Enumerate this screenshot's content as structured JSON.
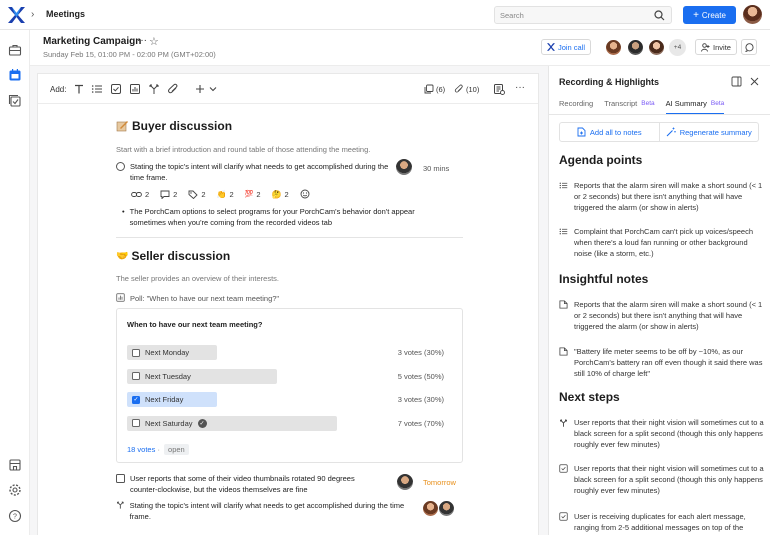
{
  "app": {
    "crumb": "Meetings",
    "search_placeholder": "Search",
    "create_label": "Create"
  },
  "colors": {
    "accent": "#1a6ef0",
    "beta": "#7a5af5",
    "later": "#e8901c"
  },
  "meeting": {
    "title": "Marketing Campaign",
    "datetime": "Sunday Feb 15, 01:00 PM - 02:00 PM (GMT+02:00)",
    "join_label": "Join call",
    "more_participants": "+4",
    "invite_label": "Invite"
  },
  "toolbar": {
    "add_label": "Add:",
    "notes_count": "(6)",
    "attachments_count": "(10)"
  },
  "buyer": {
    "heading": "Buyer discussion",
    "intro": "Start with a brief introduction and round table of those attending the meeting.",
    "task_text": "Stating the topic's intent will clarify what needs to get accomplished during the time frame.",
    "task_duration": "30 mins",
    "chips": [
      "2",
      "2",
      "2",
      "2",
      "2",
      "2"
    ],
    "bullet": "The PorchCam options to select programs for your PorchCam's behavior don't appear sometimes when you're coming from the recorded videos tab"
  },
  "seller": {
    "heading": "Seller discussion",
    "intro": "The seller provides an overview of their interests.",
    "poll_label": "Poll:",
    "poll_quote": "\"When to have our next team meeting?\"",
    "poll_question": "When to have our next team meeting?",
    "options": [
      {
        "label": "Next Monday",
        "votes": "3 votes (30%)",
        "share": 0.3
      },
      {
        "label": "Next Tuesday",
        "votes": "5 votes (50%)",
        "share": 0.5
      },
      {
        "label": "Next Friday",
        "votes": "3 votes (30%)",
        "share": 0.3,
        "selected": true
      },
      {
        "label": "Next Saturday",
        "votes": "7 votes (70%)",
        "share": 0.7
      }
    ],
    "total_votes": "18 votes",
    "separator": "·",
    "status": "open"
  },
  "bottom_tasks": [
    {
      "text": "User reports that some of their video thumbnails rotated 90 degrees counter-clockwise, but the videos themselves are fine",
      "due": "Tomorrow"
    },
    {
      "text": "Stating the topic's intent will clarify what needs to get accomplished during the time frame."
    }
  ],
  "panel": {
    "title": "Recording & Highlights",
    "tabs": [
      {
        "label": "Recording",
        "badge": ""
      },
      {
        "label": "Transcript",
        "badge": "Beta"
      },
      {
        "label": "AI Summary",
        "badge": "Beta"
      }
    ],
    "add_notes_label": "Add all to notes",
    "regenerate_label": "Regenerate summary",
    "agenda_heading": "Agenda points",
    "agenda": [
      "Reports that the alarm siren will make a short sound (< 1 or 2 seconds) but there isn't anything that will have triggered the alarm (or show in alerts)",
      "Complaint that PorchCam can't pick up voices/speech when there's a loud fan running or other background noise (like a storm, etc.)"
    ],
    "insights_heading": "Insightful notes",
    "insights": [
      "Reports that the alarm siren will make a short sound (< 1 or 2 seconds) but there isn't anything that will have triggered the alarm (or show in alerts)",
      "\"Battery life meter seems to be off by ~10%, as our PorchCam's battery ran off even though it said there was still 10% of charge left\""
    ],
    "next_heading": "Next steps",
    "next": [
      "User reports that their night vision will sometimes cut to a black screen for a split second (though this only happens roughly ever few minutes)",
      "User reports that their night vision will sometimes cut to a black screen for a split second (though this only happens roughly ever few minutes)",
      "User is receiving duplicates for each alert message, ranging from 2-5 additional messages on top of the"
    ]
  }
}
